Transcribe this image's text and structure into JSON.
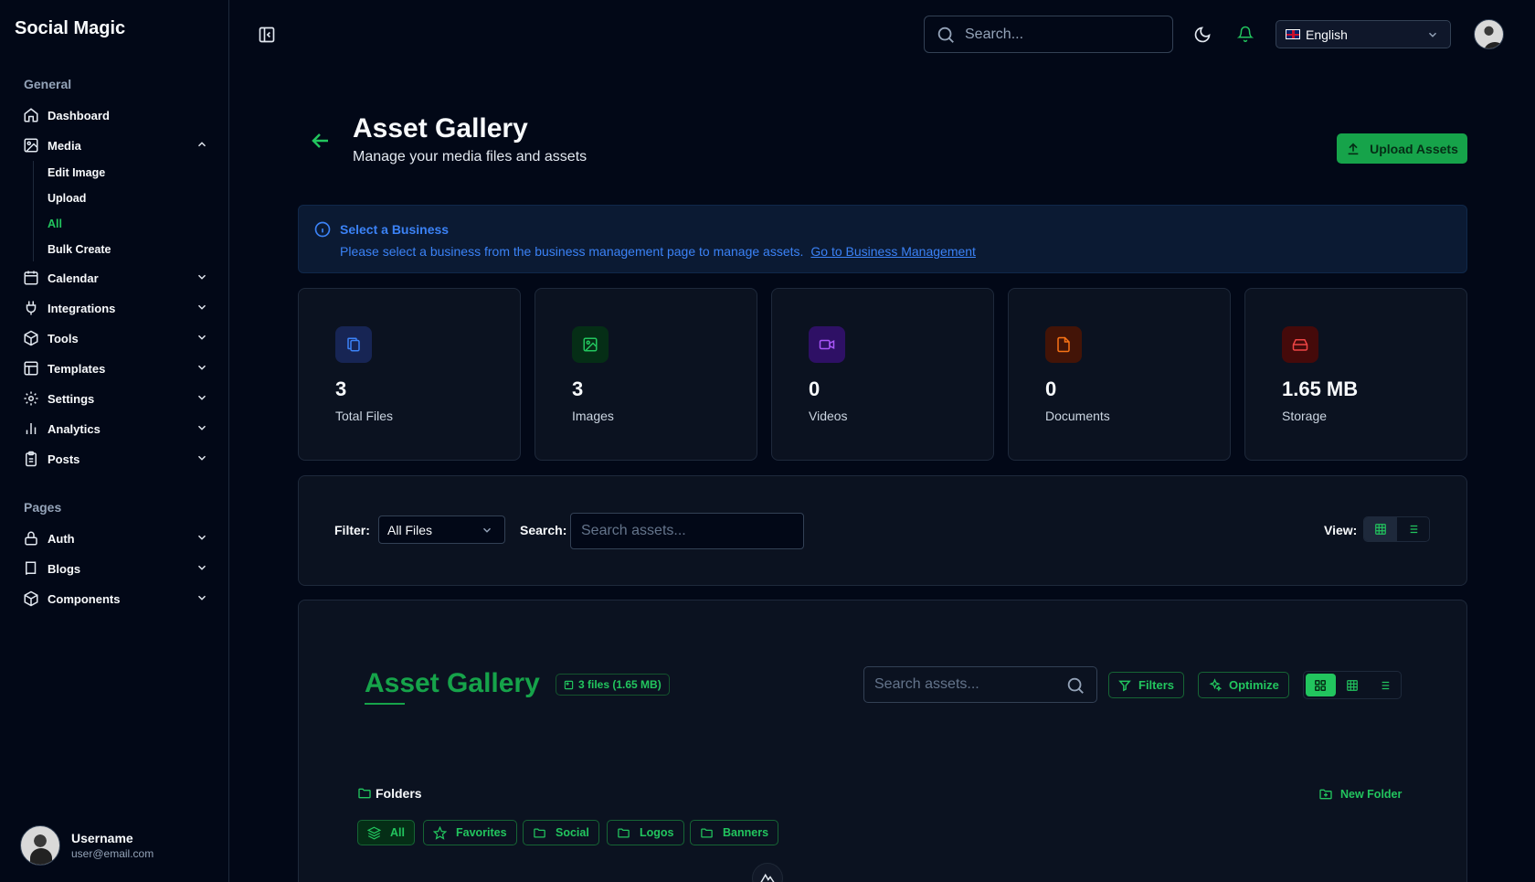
{
  "app": {
    "brand": "Social Magic"
  },
  "sidebar": {
    "general_title": "General",
    "pages_title": "Pages",
    "items": [
      {
        "label": "Dashboard",
        "icon": "home-icon"
      },
      {
        "label": "Media",
        "icon": "image-icon"
      },
      {
        "label": "Calendar",
        "icon": "calendar-icon"
      },
      {
        "label": "Integrations",
        "icon": "plug-icon"
      },
      {
        "label": "Tools",
        "icon": "box-icon"
      },
      {
        "label": "Templates",
        "icon": "layout-icon"
      },
      {
        "label": "Settings",
        "icon": "gear-icon"
      },
      {
        "label": "Analytics",
        "icon": "bar-chart-icon"
      },
      {
        "label": "Posts",
        "icon": "clipboard-icon"
      }
    ],
    "media_sub": [
      "Edit Image",
      "Upload",
      "All",
      "Bulk Create"
    ],
    "page_items": [
      {
        "label": "Auth",
        "icon": "lock-icon"
      },
      {
        "label": "Blogs",
        "icon": "book-icon"
      },
      {
        "label": "Components",
        "icon": "box-icon"
      }
    ],
    "user": {
      "name": "Username",
      "email": "user@email.com"
    }
  },
  "topbar": {
    "search_placeholder": "Search...",
    "language": "English"
  },
  "header": {
    "title": "Asset Gallery",
    "subtitle": "Manage your media files and assets",
    "upload_label": "Upload Assets"
  },
  "alert": {
    "title": "Select a Business",
    "text": "Please select a business from the business management page to manage assets.",
    "link": "Go to Business Management"
  },
  "stats": [
    {
      "value": "3",
      "label": "Total Files",
      "color": "#3b82f6",
      "bg": "#172554"
    },
    {
      "value": "3",
      "label": "Images",
      "color": "#22c55e",
      "bg": "#052e16"
    },
    {
      "value": "0",
      "label": "Videos",
      "color": "#a855f7",
      "bg": "#2e1065"
    },
    {
      "value": "0",
      "label": "Documents",
      "color": "#f97316",
      "bg": "#431407"
    },
    {
      "value": "1.65 MB",
      "label": "Storage",
      "color": "#ef4444",
      "bg": "#450a0a"
    }
  ],
  "filters": {
    "filter_label": "Filter:",
    "filter_value": "All Files",
    "search_label": "Search:",
    "search_placeholder": "Search assets...",
    "view_label": "View:"
  },
  "gallery": {
    "title": "Asset Gallery",
    "count": "3 files (1.65 MB)",
    "search_placeholder": "Search assets...",
    "filters_label": "Filters",
    "optimize_label": "Optimize",
    "folders_title": "Folders",
    "new_folder": "New Folder",
    "chips": [
      "All",
      "Favorites",
      "Social",
      "Logos",
      "Banners"
    ]
  },
  "colors": {
    "accent": "#22c55e",
    "info": "#3b82f6"
  }
}
